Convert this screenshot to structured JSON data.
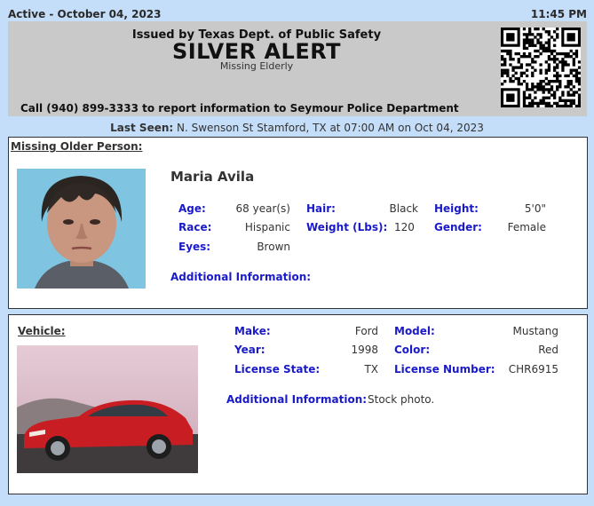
{
  "header": {
    "status": "Active - October 04, 2023",
    "time": "11:45 PM"
  },
  "banner": {
    "issued_by": "Issued by Texas Dept. of Public Safety",
    "title": "SILVER ALERT",
    "subtitle": "Missing Elderly",
    "call_text": "Call (940) 899-3333 to report information to Seymour Police Department"
  },
  "last_seen": {
    "label": "Last Seen:",
    "text": "N. Swenson St Stamford, TX at 07:00 AM on Oct 04, 2023"
  },
  "person": {
    "section_title": "Missing Older Person:",
    "name": "Maria Avila",
    "fields": {
      "age_label": "Age:",
      "age": "68 year(s)",
      "hair_label": "Hair:",
      "hair": "Black",
      "height_label": "Height:",
      "height": "5'0\"",
      "race_label": "Race:",
      "race": "Hispanic",
      "weight_label": "Weight (Lbs):",
      "weight": "120",
      "gender_label": "Gender:",
      "gender": "Female",
      "eyes_label": "Eyes:",
      "eyes": "Brown"
    },
    "additional_label": "Additional Information:"
  },
  "vehicle": {
    "section_title": "Vehicle:",
    "fields": {
      "make_label": "Make:",
      "make": "Ford",
      "model_label": "Model:",
      "model": "Mustang",
      "year_label": "Year:",
      "year": "1998",
      "color_label": "Color:",
      "color": "Red",
      "license_state_label": "License State:",
      "license_state": "TX",
      "license_number_label": "License Number:",
      "license_number": "CHR6915"
    },
    "additional_label": "Additional Information:",
    "additional_text": "Stock photo."
  },
  "colors": {
    "page_bg": "#c4ddf8",
    "banner_bg": "#c9c9c9",
    "label_blue": "#1a1ac8"
  }
}
